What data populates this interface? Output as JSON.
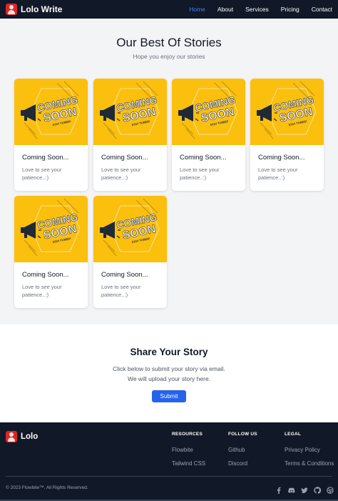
{
  "nav": {
    "brand": "Lolo Write",
    "links": [
      {
        "label": "Home",
        "active": true
      },
      {
        "label": "About",
        "active": false
      },
      {
        "label": "Services",
        "active": false
      },
      {
        "label": "Pricing",
        "active": false
      },
      {
        "label": "Contact",
        "active": false
      }
    ]
  },
  "stories": {
    "title": "Our Best Of Stories",
    "subtitle": "Hope you enjoy our stories",
    "image_text": {
      "line1": "COMING",
      "line2": "SOON",
      "line3": "STAY TUNED!"
    },
    "cards": [
      {
        "title": "Coming Soon...",
        "desc": "Love to see your patience..:)"
      },
      {
        "title": "Coming Soon...",
        "desc": "Love to see your patience..:)"
      },
      {
        "title": "Coming Soon...",
        "desc": "Love to see your patience..:)"
      },
      {
        "title": "Coming Soon...",
        "desc": "Love to see your patience..:)"
      },
      {
        "title": "Coming Soon...",
        "desc": "Love to see your patience..:)"
      },
      {
        "title": "Coming Soon...",
        "desc": "Love to see your patience..:)"
      }
    ]
  },
  "share": {
    "title": "Share Your Story",
    "line1": "Click below to submit your story via email.",
    "line2": "We will upload your story here.",
    "button": "Submit"
  },
  "footer": {
    "brand": "Lolo",
    "columns": [
      {
        "heading": "RESOURCES",
        "items": [
          "Flowbite",
          "Tailwind CSS"
        ]
      },
      {
        "heading": "FOLLOW US",
        "items": [
          "Github",
          "Discord"
        ]
      },
      {
        "heading": "LEGAL",
        "items": [
          "Privacy Policy",
          "Terms & Conditions"
        ]
      }
    ],
    "copyright": "© 2023 Flowbite™. All Rights Reserved.",
    "social_icons": [
      "facebook-icon",
      "discord-icon",
      "twitter-icon",
      "github-icon",
      "dribbble-icon"
    ]
  },
  "colors": {
    "nav_bg": "#111827",
    "active_link": "#3b82f6",
    "card_image_bg": "#fbbf0e",
    "button": "#2563eb",
    "footer_bg": "#111827"
  }
}
